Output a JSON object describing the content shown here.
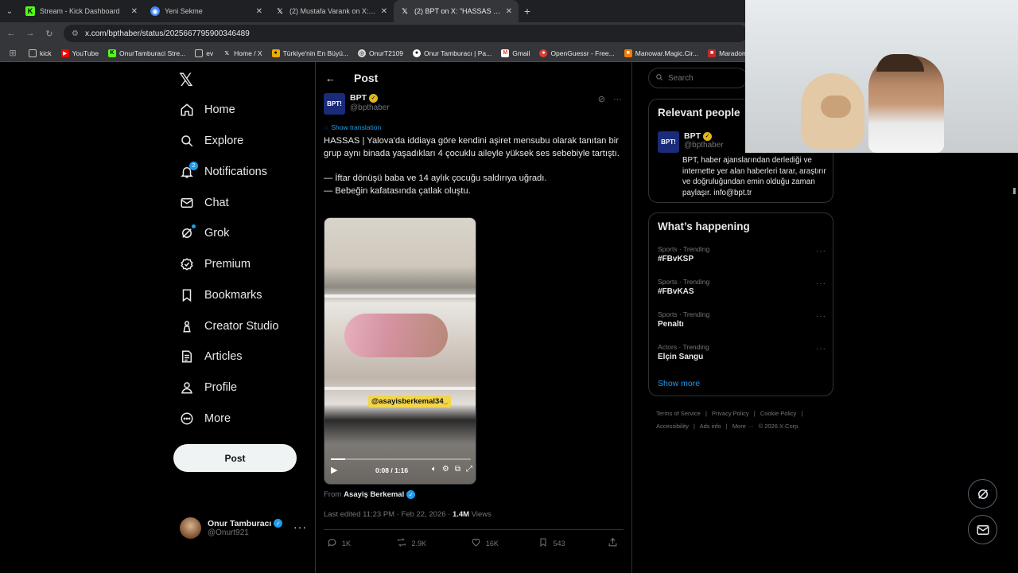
{
  "browser": {
    "tabs": [
      {
        "title": "Stream - Kick Dashboard",
        "icon": "kick-icon"
      },
      {
        "title": "Yeni Sekme",
        "icon": "chrome-icon"
      },
      {
        "title": "(2) Mustafa Varank on X: \"Nede",
        "icon": "x-icon"
      },
      {
        "title": "(2) BPT on X: \"HASSAS | Yalova'",
        "icon": "x-icon"
      }
    ],
    "url": "x.com/bpthaber/status/2025667795900346489",
    "bookmarks": [
      {
        "label": "kick",
        "icon": "folder-icon"
      },
      {
        "label": "YouTube",
        "icon": "youtube-icon"
      },
      {
        "label": "OnurTamburaci Stre...",
        "icon": "kick-icon"
      },
      {
        "label": "ev",
        "icon": "folder-icon"
      },
      {
        "label": "Home / X",
        "icon": "x-icon"
      },
      {
        "label": "Türkiye'nin En Büyü...",
        "icon": "site-icon"
      },
      {
        "label": "OnurT2109",
        "icon": "site-icon"
      },
      {
        "label": "Onur Tamburacı | Pa...",
        "icon": "site-icon"
      },
      {
        "label": "Gmail",
        "icon": "gmail-icon"
      },
      {
        "label": "OpenGuessr - Free...",
        "icon": "site-icon"
      },
      {
        "label": "Manowar.Magic.Cir...",
        "icon": "site-icon"
      },
      {
        "label": "Maradona: Blessed...",
        "icon": "site-icon"
      }
    ]
  },
  "nav": {
    "logo": "𝕏",
    "items": [
      {
        "label": "Home",
        "icon": "home-icon"
      },
      {
        "label": "Explore",
        "icon": "search-icon"
      },
      {
        "label": "Notifications",
        "icon": "bell-icon",
        "badge": "2"
      },
      {
        "label": "Chat",
        "icon": "mail-icon"
      },
      {
        "label": "Grok",
        "icon": "grok-icon"
      },
      {
        "label": "Premium",
        "icon": "premium-icon"
      },
      {
        "label": "Bookmarks",
        "icon": "bookmark-icon"
      },
      {
        "label": "Creator Studio",
        "icon": "creator-icon"
      },
      {
        "label": "Articles",
        "icon": "articles-icon"
      },
      {
        "label": "Profile",
        "icon": "person-icon"
      },
      {
        "label": "More",
        "icon": "more-icon"
      }
    ],
    "post_label": "Post",
    "account": {
      "name": "Onur Tamburacı",
      "handle": "@Onurt921"
    }
  },
  "post": {
    "header_title": "Post",
    "author": {
      "name": "BPT",
      "handle": "@bpthaber",
      "logo_text": "BPT!"
    },
    "show_translation": "Show translation",
    "text_1": "HASSAS | Yalova'da iddiaya göre kendini aşiret mensubu olarak tanıtan bir grup aynı binada yaşadıkları 4 çocuklu aileyle yüksek ses sebebiyle tartıştı.",
    "text_2": "— İftar dönüşü baba ve 14 aylık çocuğu saldırıya uğradı.",
    "text_3": "— Bebeğin kafatasında çatlak oluştu.",
    "video": {
      "watermark": "@asayisberkemal34_",
      "time": "0:08 / 1:16",
      "progress": 0.105
    },
    "from_prefix": "From",
    "from_source": "Asayiş Berkemal",
    "edited": "Last edited 11:23 PM · Feb 22, 2026 ·",
    "views_count": "1.4M",
    "views_label": "Views",
    "stats": {
      "replies": "1K",
      "reposts": "2.9K",
      "likes": "16K",
      "bookmarks": "543"
    }
  },
  "sidebar": {
    "search_placeholder": "Search",
    "relevant_title": "Relevant people",
    "relevant_user": {
      "name": "BPT",
      "handle": "@bpthaber",
      "bio": "BPT, haber ajanslarından derlediği ve internette yer alan haberleri tarar, araştırır ve doğruluğundan emin olduğu zaman paylaşır. info@bpt.tr"
    },
    "happening_title": "What’s happening",
    "trends": [
      {
        "category": "Sports · Trending",
        "tag": "#FBvKSP"
      },
      {
        "category": "Sports · Trending",
        "tag": "#FBvKAS"
      },
      {
        "category": "Sports · Trending",
        "tag": "Penaltı"
      },
      {
        "category": "Actors · Trending",
        "tag": "Elçin Sangu"
      }
    ],
    "show_more": "Show more",
    "footer": [
      "Terms of Service",
      "|",
      "Privacy Policy",
      "|",
      "Cookie Policy",
      "|",
      "Accessibility",
      "|",
      "Ads info",
      "|",
      "More ···",
      "© 2026 X Corp."
    ]
  },
  "colors": {
    "accent": "#1d9bf0",
    "background": "#000000",
    "gold_badge": "#e2b719"
  }
}
